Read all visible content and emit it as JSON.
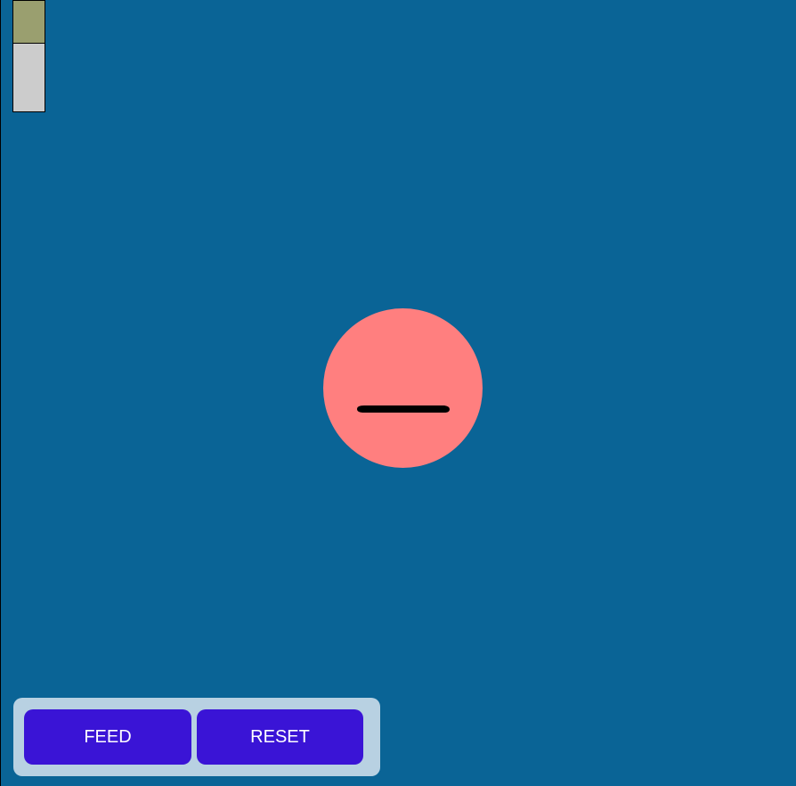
{
  "meter": {
    "level": 0.39,
    "fill_color": "#9a9f6f",
    "empty_color": "#cccccc"
  },
  "creature": {
    "body_color": "#ff7f7f",
    "expression": "neutral-mouth"
  },
  "controls": {
    "feed_label": "FEED",
    "reset_label": "RESET",
    "button_color": "#3a14d6"
  },
  "colors": {
    "background": "#0a6496",
    "panel": "#b8d1e2"
  }
}
